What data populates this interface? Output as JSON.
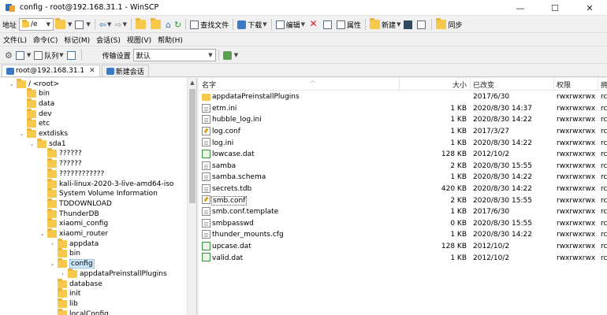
{
  "window": {
    "title": "config - root@192.168.31.1 - WinSCP",
    "controls": {
      "minimize": "—",
      "maximize": "☐",
      "close": "✕"
    }
  },
  "address_bar": {
    "label": "地址",
    "path": "/e",
    "find_files": "查找文件",
    "download": "下载",
    "edit": "编辑",
    "properties": "属性",
    "new": "新建",
    "sync": "同步"
  },
  "menu": [
    "文件(L)",
    "命令(C)",
    "标记(M)",
    "会话(S)",
    "视图(V)",
    "帮助(H)"
  ],
  "toolbar3": {
    "queue": "队列",
    "transfer_settings_label": "传输设置",
    "transfer_settings_value": "默认"
  },
  "tabs": [
    {
      "label": "root@192.168.31.1",
      "close": "✕"
    },
    {
      "label": "新建会话"
    }
  ],
  "tree": [
    {
      "label": "/ <root>",
      "level": 0,
      "expanded": true
    },
    {
      "label": "bin",
      "level": 1
    },
    {
      "label": "data",
      "level": 1
    },
    {
      "label": "dev",
      "level": 1
    },
    {
      "label": "etc",
      "level": 1
    },
    {
      "label": "extdisks",
      "level": 1,
      "expanded": true
    },
    {
      "label": "sda1",
      "level": 2,
      "expanded": true
    },
    {
      "label": "??????",
      "level": 3
    },
    {
      "label": "??????",
      "level": 3
    },
    {
      "label": "????????????",
      "level": 3
    },
    {
      "label": "kali-linux-2020-3-live-amd64-iso",
      "level": 3
    },
    {
      "label": "System Volume Information",
      "level": 3
    },
    {
      "label": "TDDOWNLOAD",
      "level": 3
    },
    {
      "label": "ThunderDB",
      "level": 3
    },
    {
      "label": "xiaomi_config",
      "level": 3
    },
    {
      "label": "xiaomi_router",
      "level": 3,
      "expanded": true
    },
    {
      "label": "appdata",
      "level": 4,
      "collapsed": true
    },
    {
      "label": "bin",
      "level": 4
    },
    {
      "label": "config",
      "level": 4,
      "expanded": true,
      "selected": true
    },
    {
      "label": "appdataPreinstallPlugins",
      "level": 5,
      "collapsed": true
    },
    {
      "label": "database",
      "level": 4
    },
    {
      "label": "init",
      "level": 4
    },
    {
      "label": "lib",
      "level": 4
    },
    {
      "label": "localConfig",
      "level": 4
    }
  ],
  "file_list": {
    "columns": {
      "name": "名字",
      "size": "大小",
      "modified": "已改变",
      "rights": "权限",
      "owner": "拥"
    },
    "rows": [
      {
        "icon": "folder",
        "name": "appdataPreinstallPlugins",
        "size": "",
        "modified": "2017/6/30",
        "rights": "rwxrwxrwx",
        "owner": "rc"
      },
      {
        "icon": "doc",
        "name": "etm.ini",
        "size": "1 KB",
        "modified": "2020/8/30 14:37",
        "rights": "rwxrwxrwx",
        "owner": "rc"
      },
      {
        "icon": "doc",
        "name": "hubble_log.ini",
        "size": "1 KB",
        "modified": "2020/8/30 14:22",
        "rights": "rwxrwxrwx",
        "owner": "rc"
      },
      {
        "icon": "cfg",
        "name": "log.conf",
        "size": "1 KB",
        "modified": "2017/3/27",
        "rights": "rwxrwxrwx",
        "owner": "rc"
      },
      {
        "icon": "doc",
        "name": "log.ini",
        "size": "1 KB",
        "modified": "2020/8/30 14:22",
        "rights": "rwxrwxrwx",
        "owner": "rc"
      },
      {
        "icon": "dat",
        "name": "lowcase.dat",
        "size": "128 KB",
        "modified": "2012/10/2",
        "rights": "rwxrwxrwx",
        "owner": "rc"
      },
      {
        "icon": "doc",
        "name": "samba",
        "size": "2 KB",
        "modified": "2020/8/30 15:55",
        "rights": "rwxrwxrwx",
        "owner": "rc"
      },
      {
        "icon": "doc",
        "name": "samba.schema",
        "size": "1 KB",
        "modified": "2020/8/30 14:22",
        "rights": "rwxrwxrwx",
        "owner": "rc"
      },
      {
        "icon": "doc",
        "name": "secrets.tdb",
        "size": "420 KB",
        "modified": "2020/8/30 14:22",
        "rights": "rwxrwxrwx",
        "owner": "rc"
      },
      {
        "icon": "cfg",
        "name": "smb.conf",
        "size": "2 KB",
        "modified": "2020/8/30 15:55",
        "rights": "rwxrwxrwx",
        "owner": "rc",
        "selected": true
      },
      {
        "icon": "doc",
        "name": "smb.conf.template",
        "size": "1 KB",
        "modified": "2017/6/30",
        "rights": "rwxrwxrwx",
        "owner": "rc"
      },
      {
        "icon": "doc",
        "name": "smbpasswd",
        "size": "0 KB",
        "modified": "2020/8/30 15:55",
        "rights": "rwxrwxrwx",
        "owner": "rc"
      },
      {
        "icon": "doc",
        "name": "thunder_mounts.cfg",
        "size": "1 KB",
        "modified": "2020/8/30 14:22",
        "rights": "rwxrwxrwx",
        "owner": "rc"
      },
      {
        "icon": "dat",
        "name": "upcase.dat",
        "size": "128 KB",
        "modified": "2012/10/2",
        "rights": "rwxrwxrwx",
        "owner": "rc"
      },
      {
        "icon": "dat",
        "name": "valid.dat",
        "size": "1 KB",
        "modified": "2012/10/2",
        "rights": "rwxrwxrwx",
        "owner": "rc"
      }
    ]
  }
}
